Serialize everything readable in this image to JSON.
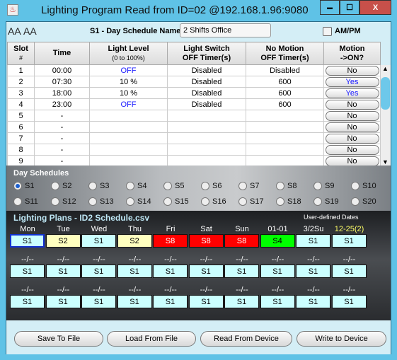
{
  "window": {
    "title": "Lighting Program Read from ID=02 @192.168.1.96:9080",
    "minimize": "▬",
    "maximize": "☐",
    "close": "X"
  },
  "toolbar": {
    "font_up": "AA",
    "font_down": "AA",
    "schedule_name_label": "S1 - Day Schedule Name:",
    "schedule_name_value": "2 Shifts Office",
    "ampm_label": "AM/PM",
    "ampm_checked": false
  },
  "table": {
    "headers": [
      {
        "l1": "Slot",
        "l2": "#"
      },
      {
        "l1": "Time",
        "l2": ""
      },
      {
        "l1": "Light Level",
        "l2": "(0 to 100%)"
      },
      {
        "l1": "Light Switch",
        "l2": "OFF Timer(s)"
      },
      {
        "l1": "No Motion",
        "l2": "OFF Timer(s)"
      },
      {
        "l1": "Motion",
        "l2": "->ON?"
      }
    ],
    "rows": [
      {
        "slot": "1",
        "time": "00:00",
        "level": "OFF",
        "switch": "Disabled",
        "nomotion": "Disabled",
        "motion": "No"
      },
      {
        "slot": "2",
        "time": "07:30",
        "level": "10 %",
        "switch": "Disabled",
        "nomotion": "600",
        "motion": "Yes"
      },
      {
        "slot": "3",
        "time": "18:00",
        "level": "10 %",
        "switch": "Disabled",
        "nomotion": "600",
        "motion": "Yes"
      },
      {
        "slot": "4",
        "time": "23:00",
        "level": "OFF",
        "switch": "Disabled",
        "nomotion": "600",
        "motion": "No"
      },
      {
        "slot": "5",
        "time": "-",
        "level": "",
        "switch": "",
        "nomotion": "",
        "motion": "No"
      },
      {
        "slot": "6",
        "time": "-",
        "level": "",
        "switch": "",
        "nomotion": "",
        "motion": "No"
      },
      {
        "slot": "7",
        "time": "-",
        "level": "",
        "switch": "",
        "nomotion": "",
        "motion": "No"
      },
      {
        "slot": "8",
        "time": "-",
        "level": "",
        "switch": "",
        "nomotion": "",
        "motion": "No"
      },
      {
        "slot": "9",
        "time": "-",
        "level": "",
        "switch": "",
        "nomotion": "",
        "motion": "No"
      }
    ]
  },
  "day_schedules": {
    "title": "Day Schedules",
    "selected": "S1",
    "options": [
      "S1",
      "S2",
      "S3",
      "S4",
      "S5",
      "S6",
      "S7",
      "S8",
      "S9",
      "S10",
      "S11",
      "S12",
      "S13",
      "S14",
      "S15",
      "S16",
      "S17",
      "S18",
      "S19",
      "S20"
    ]
  },
  "plans": {
    "title": "Lighting Plans - ID2 Schedule.csv",
    "user_defined_label": "User-defined Dates",
    "rows": [
      {
        "labels": [
          "Mon",
          "Tue",
          "Wed",
          "Thu",
          "Fri",
          "Sat",
          "Sun",
          "01-01",
          "3/2Su",
          "12-25(2)"
        ],
        "cells": [
          "S1",
          "S2",
          "S1",
          "S2",
          "S8",
          "S8",
          "S8",
          "S4",
          "S1",
          "S1"
        ]
      },
      {
        "labels": [
          "--/--",
          "--/--",
          "--/--",
          "--/--",
          "--/--",
          "--/--",
          "--/--",
          "--/--",
          "--/--",
          "--/--"
        ],
        "cells": [
          "S1",
          "S1",
          "S1",
          "S1",
          "S1",
          "S1",
          "S1",
          "S1",
          "S1",
          "S1"
        ]
      },
      {
        "labels": [
          "--/--",
          "--/--",
          "--/--",
          "--/--",
          "--/--",
          "--/--",
          "--/--",
          "--/--",
          "--/--",
          "--/--"
        ],
        "cells": [
          "S1",
          "S1",
          "S1",
          "S1",
          "S1",
          "S1",
          "S1",
          "S1",
          "S1",
          "S1"
        ]
      }
    ],
    "colors": {
      "S1": "#cbffff",
      "S2": "#ffffbf",
      "S8": "#ff0000",
      "S4": "#00ff00"
    },
    "highlight_label_color": "#ffff66"
  },
  "buttons": {
    "save": "Save To File",
    "load": "Load From File",
    "read": "Read From Device",
    "write": "Write to Device"
  }
}
